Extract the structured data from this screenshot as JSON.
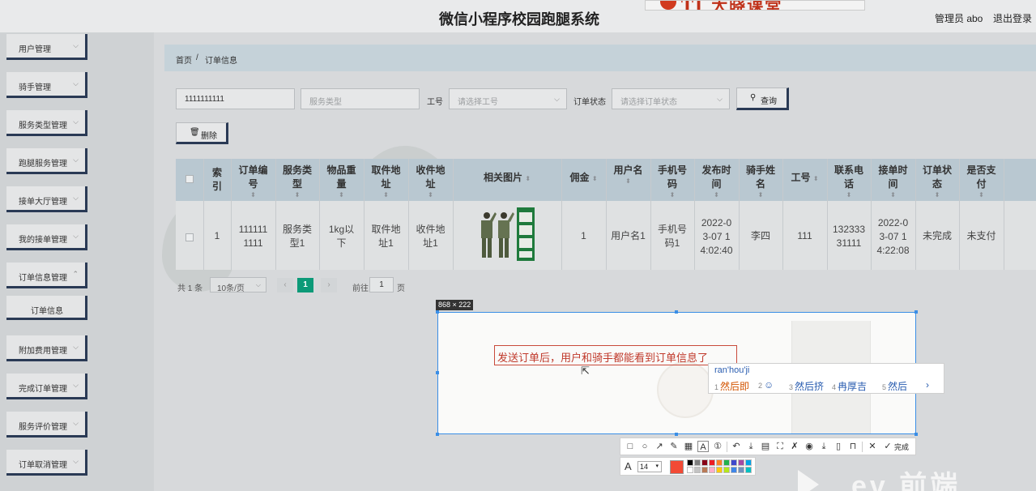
{
  "header": {
    "app_title": "微信小程序校园跑腿系统",
    "admin_label": "管理员 abo",
    "logout_label": "退出登录",
    "logo_text": "TI 大晓课堂"
  },
  "sidebar": {
    "items": [
      {
        "label": "用户管理"
      },
      {
        "label": "骑手管理"
      },
      {
        "label": "服务类型管理"
      },
      {
        "label": "跑腿服务管理"
      },
      {
        "label": "接单大厅管理"
      },
      {
        "label": "我的接单管理"
      },
      {
        "label": "订单信息管理"
      },
      {
        "label": "订单信息"
      },
      {
        "label": "附加费用管理"
      },
      {
        "label": "完成订单管理"
      },
      {
        "label": "服务评价管理"
      },
      {
        "label": "订单取消管理"
      }
    ]
  },
  "breadcrumb": {
    "home": "首页",
    "sep": "/",
    "current": "订单信息"
  },
  "search": {
    "order_no_value": "1111111111",
    "service_type_placeholder": "服务类型",
    "worker_no_label": "工号",
    "worker_no_placeholder": "请选择工号",
    "status_label": "订单状态",
    "status_placeholder": "请选择订单状态",
    "query_label": "查询",
    "delete_label": "删除"
  },
  "table": {
    "columns": [
      {
        "l1": "索",
        "l2": "引"
      },
      {
        "l1": "订单编",
        "l2": "号"
      },
      {
        "l1": "服务类",
        "l2": "型"
      },
      {
        "l1": "物品重",
        "l2": "量"
      },
      {
        "l1": "取件地",
        "l2": "址"
      },
      {
        "l1": "收件地",
        "l2": "址"
      },
      {
        "l1": "相关图片",
        "l2": ""
      },
      {
        "l1": "佣金",
        "l2": ""
      },
      {
        "l1": "用户名",
        "l2": ""
      },
      {
        "l1": "手机号",
        "l2": "码"
      },
      {
        "l1": "发布时",
        "l2": "间"
      },
      {
        "l1": "骑手姓",
        "l2": "名"
      },
      {
        "l1": "工号",
        "l2": ""
      },
      {
        "l1": "联系电",
        "l2": "话"
      },
      {
        "l1": "接单时",
        "l2": "间"
      },
      {
        "l1": "订单状",
        "l2": "态"
      },
      {
        "l1": "是否支",
        "l2": "付"
      }
    ],
    "row": {
      "index": "1",
      "order_no": [
        "111111",
        "1111"
      ],
      "service_type": [
        "服务类",
        "型1"
      ],
      "weight": [
        "1kg以",
        "下"
      ],
      "pickup": [
        "取件地",
        "址1"
      ],
      "receive": [
        "收件地",
        "址1"
      ],
      "commission": "1",
      "username": "用户名1",
      "phone": [
        "手机号",
        "码1"
      ],
      "publish_time": [
        "2022-0",
        "3-07 1",
        "4:02:40"
      ],
      "rider_name": "李四",
      "worker_no": "111",
      "contact": [
        "132333",
        "31111"
      ],
      "accept_time": [
        "2022-0",
        "3-07 1",
        "4:22:08"
      ],
      "status": "未完成",
      "paid": "未支付"
    }
  },
  "pagination": {
    "total": "共 1 条",
    "page_size": "10条/页",
    "current_page": "1",
    "goto_label": "前往",
    "goto_value": "1",
    "page_unit": "页"
  },
  "capture": {
    "size_tag": "868 × 222",
    "text_box": "发送订单后，用户和骑手都能看到订单信息了",
    "ime_pinyin": "ran'hou'ji",
    "ime_candidates": [
      {
        "num": "1",
        "text": "然后即"
      },
      {
        "num": "2",
        "text": "☺"
      },
      {
        "num": "3",
        "text": "然后挤"
      },
      {
        "num": "4",
        "text": "冉厚吉"
      },
      {
        "num": "5",
        "text": "然后"
      }
    ],
    "ime_more": "›",
    "done_label": "完成",
    "font_size": "14",
    "current_color": "#f24a35",
    "palette": [
      "#000000",
      "#7f7f7f",
      "#880015",
      "#ed1c24",
      "#ff7f27",
      "#22b14c",
      "#3f48cc",
      "#a349a4",
      "#00a2e8",
      "#ffffff",
      "#c3c3c3",
      "#b97a57",
      "#ffaec9",
      "#ffc90e",
      "#b5e61d",
      "#3f86e8",
      "#7092be",
      "#00c2c2"
    ]
  },
  "watermark": {
    "text": "ev 前端"
  }
}
